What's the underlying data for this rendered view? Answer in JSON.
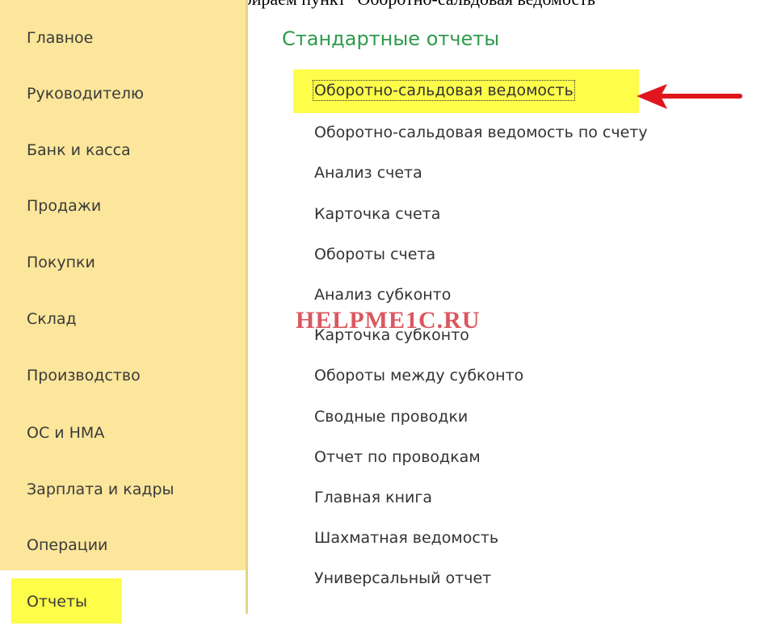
{
  "caption": "заходим в раздел \"Отчеты\" и выбираем пункт \"Оборотно-сальдовая ведомость\"",
  "sidebar": {
    "items": [
      {
        "label": "Главное"
      },
      {
        "label": "Руководителю"
      },
      {
        "label": "Банк и касса"
      },
      {
        "label": "Продажи"
      },
      {
        "label": "Покупки"
      },
      {
        "label": "Склад"
      },
      {
        "label": "Производство"
      },
      {
        "label": "ОС и НМА"
      },
      {
        "label": "Зарплата и кадры"
      },
      {
        "label": "Операции"
      },
      {
        "label": "Отчеты"
      }
    ],
    "active_index": 10
  },
  "main": {
    "section_title": "Стандартные отчеты",
    "reports": [
      {
        "label": "Оборотно-сальдовая ведомость"
      },
      {
        "label": "Оборотно-сальдовая ведомость по счету"
      },
      {
        "label": "Анализ счета"
      },
      {
        "label": "Карточка счета"
      },
      {
        "label": "Обороты счета"
      },
      {
        "label": "Анализ субконто"
      },
      {
        "label": "Карточка субконто"
      },
      {
        "label": "Обороты между субконто"
      },
      {
        "label": "Сводные проводки"
      },
      {
        "label": "Отчет по проводкам"
      },
      {
        "label": "Главная книга"
      },
      {
        "label": "Шахматная ведомость"
      },
      {
        "label": "Универсальный отчет"
      }
    ]
  },
  "watermark": "HELPME1C.RU",
  "colors": {
    "sidebar_bg": "#fbe69b",
    "highlight": "#fdfd4a",
    "section_title": "#2e9a4c",
    "arrow": "#e0161e",
    "watermark": "#d22d37"
  },
  "icons": {
    "pointer": "red-arrow-left"
  }
}
